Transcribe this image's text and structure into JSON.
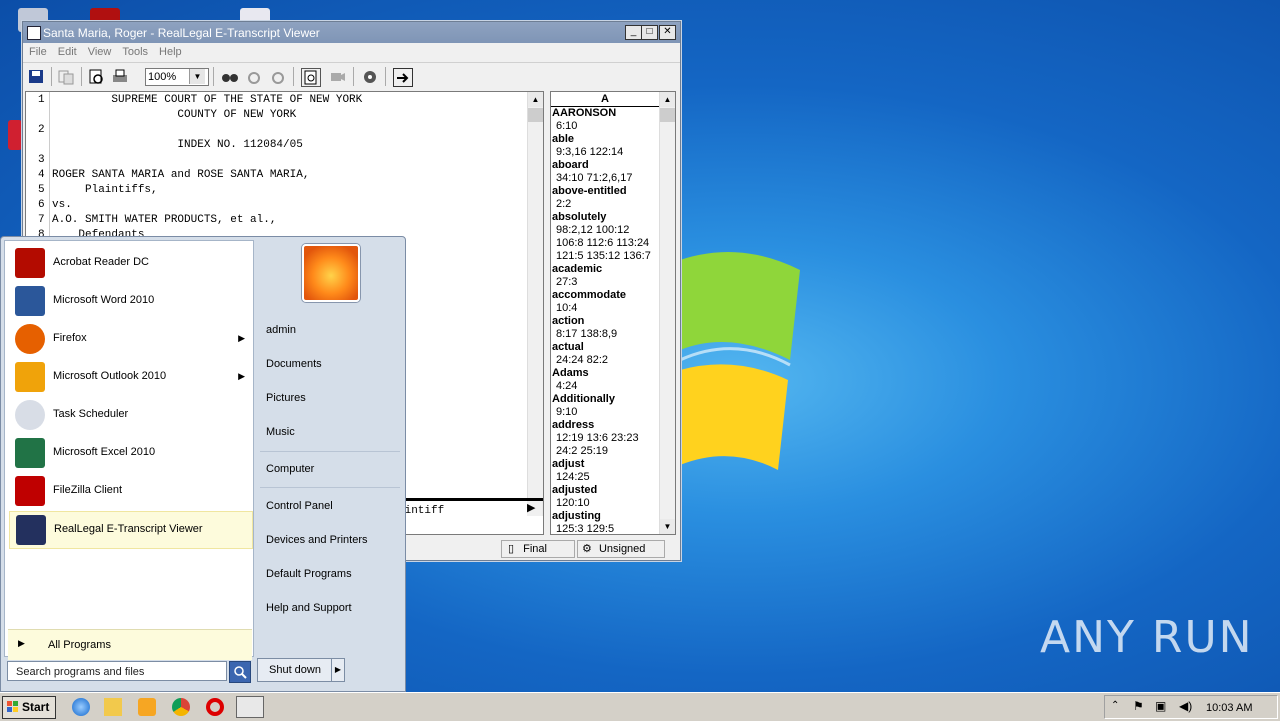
{
  "window": {
    "title": "Santa Maria, Roger - RealLegal E-Transcript Viewer",
    "menu": [
      "File",
      "Edit",
      "View",
      "Tools",
      "Help"
    ],
    "zoom": "100%",
    "status_final": "Final",
    "status_signed": "Unsigned",
    "partial_text": "aintiff"
  },
  "transcript": {
    "lines": [
      {
        "num": "1",
        "text": "         SUPREME COURT OF THE STATE OF NEW YORK"
      },
      {
        "num": "",
        "text": "                   COUNTY OF NEW YORK"
      },
      {
        "num": "2",
        "text": ""
      },
      {
        "num": "",
        "text": "                   INDEX NO. 112084/05"
      },
      {
        "num": "3",
        "text": ""
      },
      {
        "num": "4",
        "text": "ROGER SANTA MARIA and ROSE SANTA MARIA,"
      },
      {
        "num": "5",
        "text": "     Plaintiffs,"
      },
      {
        "num": "6",
        "text": "vs."
      },
      {
        "num": "7",
        "text": "A.O. SMITH WATER PRODUCTS, et al.,"
      },
      {
        "num": "8",
        "text": "    Defendants"
      }
    ]
  },
  "word_index": {
    "header": "A",
    "entries": [
      {
        "word": "AARONSON",
        "refs": [
          "6:10"
        ]
      },
      {
        "word": "able",
        "refs": [
          "9:3,16 122:14"
        ]
      },
      {
        "word": "aboard",
        "refs": [
          "34:10 71:2,6,17"
        ]
      },
      {
        "word": "above-entitled",
        "refs": [
          "2:2"
        ]
      },
      {
        "word": "absolutely",
        "refs": [
          "98:2,12 100:12",
          "106:8 112:6 113:24",
          "121:5 135:12 136:7"
        ]
      },
      {
        "word": "academic",
        "refs": [
          "27:3"
        ]
      },
      {
        "word": "accommodate",
        "refs": [
          "10:4"
        ]
      },
      {
        "word": "action",
        "refs": [
          "8:17 138:8,9"
        ]
      },
      {
        "word": "actual",
        "refs": [
          "24:24 82:2"
        ]
      },
      {
        "word": "Adams",
        "refs": [
          "4:24"
        ]
      },
      {
        "word": "Additionally",
        "refs": [
          "9:10"
        ]
      },
      {
        "word": "address",
        "refs": [
          "12:19 13:6 23:23",
          "24:2 25:19"
        ]
      },
      {
        "word": "adjust",
        "refs": [
          "124:25"
        ]
      },
      {
        "word": "adjusted",
        "refs": [
          "120:10"
        ]
      },
      {
        "word": "adjusting",
        "refs": [
          "125:3 129:5"
        ]
      }
    ]
  },
  "start_menu": {
    "programs": [
      {
        "label": "Acrobat Reader DC",
        "icon": "acrobat-icon",
        "arrow": false
      },
      {
        "label": "Microsoft Word 2010",
        "icon": "word-icon",
        "arrow": false
      },
      {
        "label": "Firefox",
        "icon": "firefox-icon",
        "arrow": true
      },
      {
        "label": "Microsoft Outlook 2010",
        "icon": "outlook-icon",
        "arrow": true
      },
      {
        "label": "Task Scheduler",
        "icon": "clock-icon",
        "arrow": false
      },
      {
        "label": "Microsoft Excel 2010",
        "icon": "excel-icon",
        "arrow": false
      },
      {
        "label": "FileZilla Client",
        "icon": "filezilla-icon",
        "arrow": false
      },
      {
        "label": "RealLegal E-Transcript Viewer",
        "icon": "reallegal-icon",
        "arrow": false
      }
    ],
    "all_programs": "All Programs",
    "search_placeholder": "Search programs and files",
    "right_links": [
      "admin",
      "Documents",
      "Pictures",
      "Music",
      "Computer",
      "Control Panel",
      "Devices and Printers",
      "Default Programs",
      "Help and Support"
    ],
    "shutdown": "Shut down"
  },
  "taskbar": {
    "start": "Start",
    "clock": "10:03 AM"
  },
  "watermark": "ANY RUN",
  "colors": {
    "desktop": "#1a7fd6",
    "titlebar": "#8ea2c0",
    "start_highlight": "#fdfbdc"
  }
}
